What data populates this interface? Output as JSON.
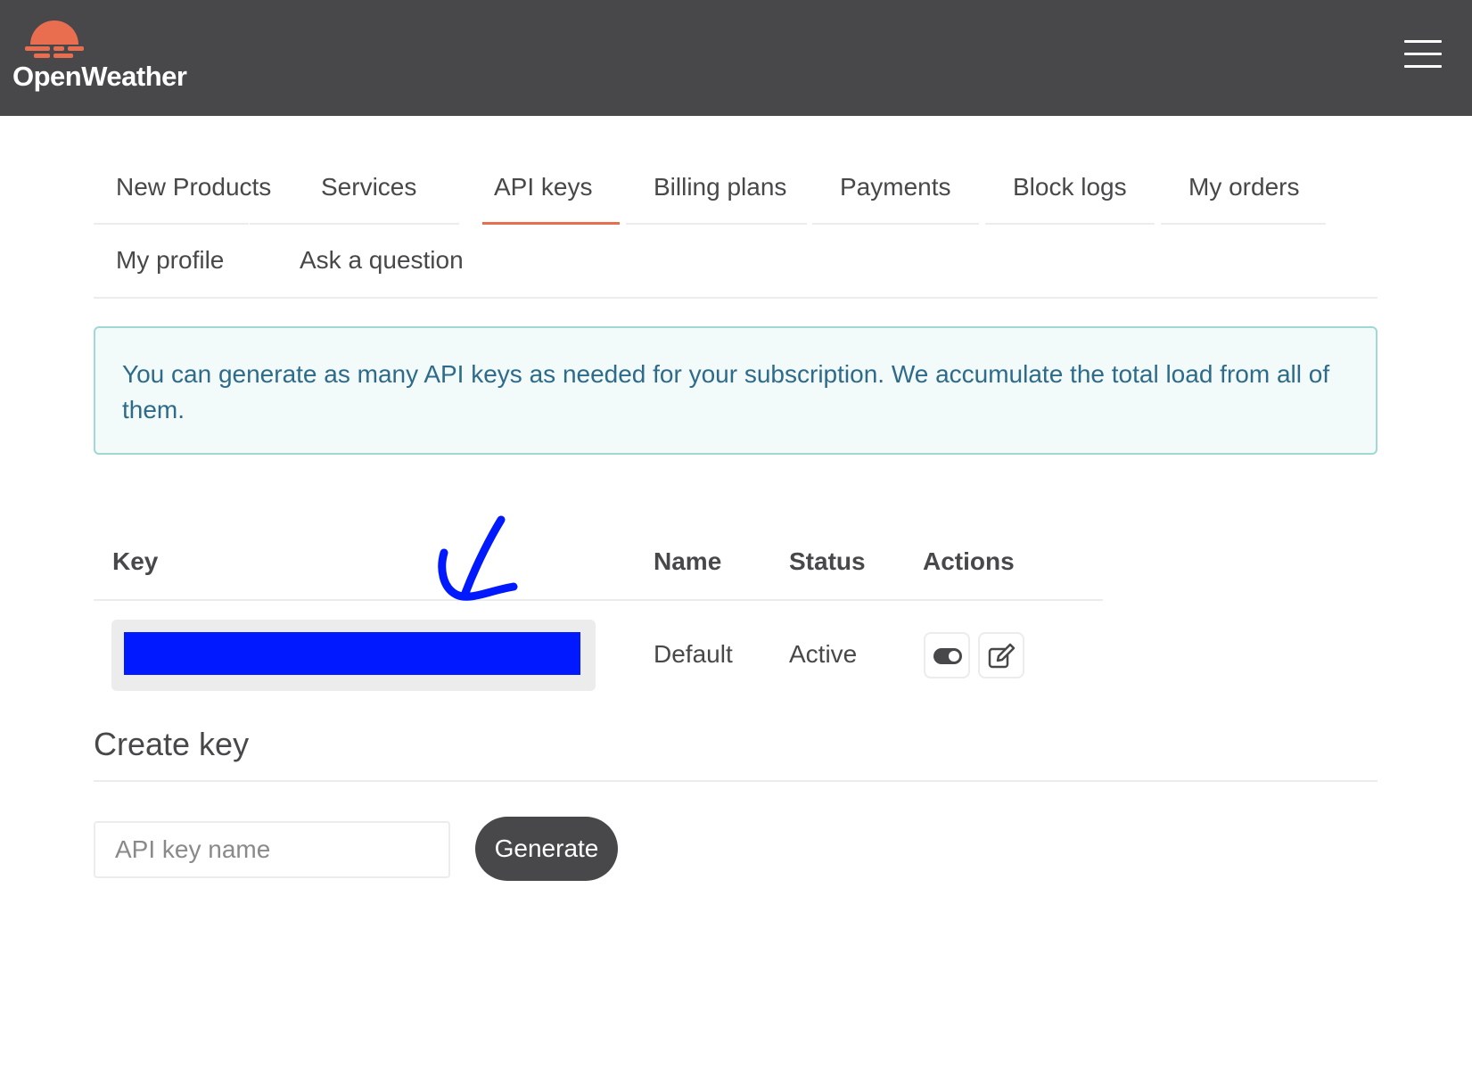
{
  "brand": {
    "name": "OpenWeather",
    "logo_color": "#e96e50"
  },
  "header": {
    "menu_icon": "hamburger-menu-icon"
  },
  "nav": {
    "tabs": [
      {
        "label": "New Products",
        "active": false
      },
      {
        "label": "Services",
        "active": false
      },
      {
        "label": "API keys",
        "active": true
      },
      {
        "label": "Billing plans",
        "active": false
      },
      {
        "label": "Payments",
        "active": false
      },
      {
        "label": "Block logs",
        "active": false
      },
      {
        "label": "My orders",
        "active": false
      },
      {
        "label": "My profile",
        "active": false
      },
      {
        "label": "Ask a question",
        "active": false
      }
    ],
    "active_color": "#e96e50"
  },
  "alert": {
    "text": "You can generate as many API keys as needed for your subscription. We accumulate the total load from all of them."
  },
  "keys_table": {
    "headers": {
      "key": "Key",
      "name": "Name",
      "status": "Status",
      "actions": "Actions"
    },
    "rows": [
      {
        "key": "",
        "key_redacted": true,
        "name": "Default",
        "status": "Active",
        "actions": [
          "toggle-icon",
          "edit-icon"
        ]
      }
    ]
  },
  "annotation": {
    "arrow_color": "#0019ff"
  },
  "create_key": {
    "title": "Create key",
    "input_placeholder": "API key name",
    "input_value": "",
    "button_label": "Generate"
  }
}
